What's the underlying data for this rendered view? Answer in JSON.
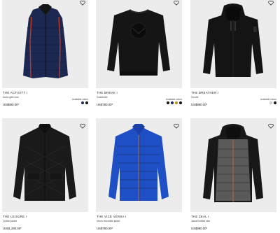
{
  "products": [
    {
      "name": "THE ACTIVITY I",
      "subtitle": "Down gilet man",
      "price": "US$690.00*",
      "swatch_label": "Available colors",
      "swatches": [
        "#1c2a55",
        "#101010"
      ]
    },
    {
      "name": "THE BREAK I",
      "subtitle": "Sweatshirt",
      "price": "US$780.00*",
      "swatch_label": "Available colors",
      "swatches": [
        "#111111",
        "#1b2a55",
        "#c28a1a",
        "#0c0c0c"
      ]
    },
    {
      "name": "THE BREATHER I",
      "subtitle": "Hoodie",
      "price": "US$890.00*",
      "swatch_label": "Available colors",
      "swatches": [
        "#e6e6e6",
        "#111111"
      ]
    },
    {
      "name": "THE LEISURE I",
      "subtitle": "Quilted jacket",
      "price": "US$1,290.00*",
      "swatch_label": "",
      "swatches": []
    },
    {
      "name": "THE VICE VERSA I",
      "subtitle": "Men's reversible jacket",
      "price": "US$790.00*",
      "swatch_label": "",
      "swatches": []
    },
    {
      "name": "THE ZEAL I",
      "subtitle": "Jacket knitted side",
      "price": "US$990.00*",
      "swatch_label": "",
      "swatches": []
    }
  ]
}
